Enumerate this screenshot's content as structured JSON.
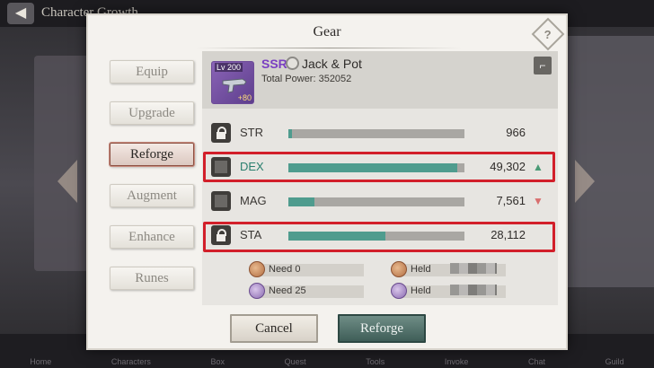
{
  "background": {
    "screen_title": "Character Growth",
    "nav_labels": [
      "Home",
      "Characters",
      "Box",
      "Quest",
      "Tools",
      "Invoke",
      "Chat",
      "Guild"
    ]
  },
  "modal": {
    "title": "Gear",
    "tabs": [
      {
        "label": "Equip",
        "active": false
      },
      {
        "label": "Upgrade",
        "active": false
      },
      {
        "label": "Reforge",
        "active": true
      },
      {
        "label": "Augment",
        "active": false
      },
      {
        "label": "Enhance",
        "active": false
      },
      {
        "label": "Runes",
        "active": false
      }
    ],
    "item": {
      "level": "Lv 200",
      "bonus": "+80",
      "rarity": "SSR",
      "name": "Jack & Pot",
      "total_power": "Total Power: 352052"
    },
    "stats": [
      {
        "name": "STR",
        "value": "966",
        "fill_pct": 2,
        "locked": true,
        "highlighted": false,
        "trend": ""
      },
      {
        "name": "DEX",
        "value": "49,302",
        "fill_pct": 96,
        "locked": false,
        "highlighted": true,
        "trend": "▲"
      },
      {
        "name": "MAG",
        "value": "7,561",
        "fill_pct": 15,
        "locked": false,
        "highlighted": false,
        "trend": "▼"
      },
      {
        "name": "STA",
        "value": "28,112",
        "fill_pct": 55,
        "locked": true,
        "highlighted": true,
        "trend": ""
      }
    ],
    "costs": {
      "need_copper": "Need 0",
      "need_shards": "Need 25",
      "held_copper": "Held",
      "held_shards": "Held"
    },
    "buttons": {
      "cancel": "Cancel",
      "reforge": "Reforge"
    },
    "help_glyph": "?",
    "colors": {
      "accent": "#4f9c8e",
      "highlight_border": "#d21f2a",
      "rarity": "#7a3fc2"
    }
  }
}
